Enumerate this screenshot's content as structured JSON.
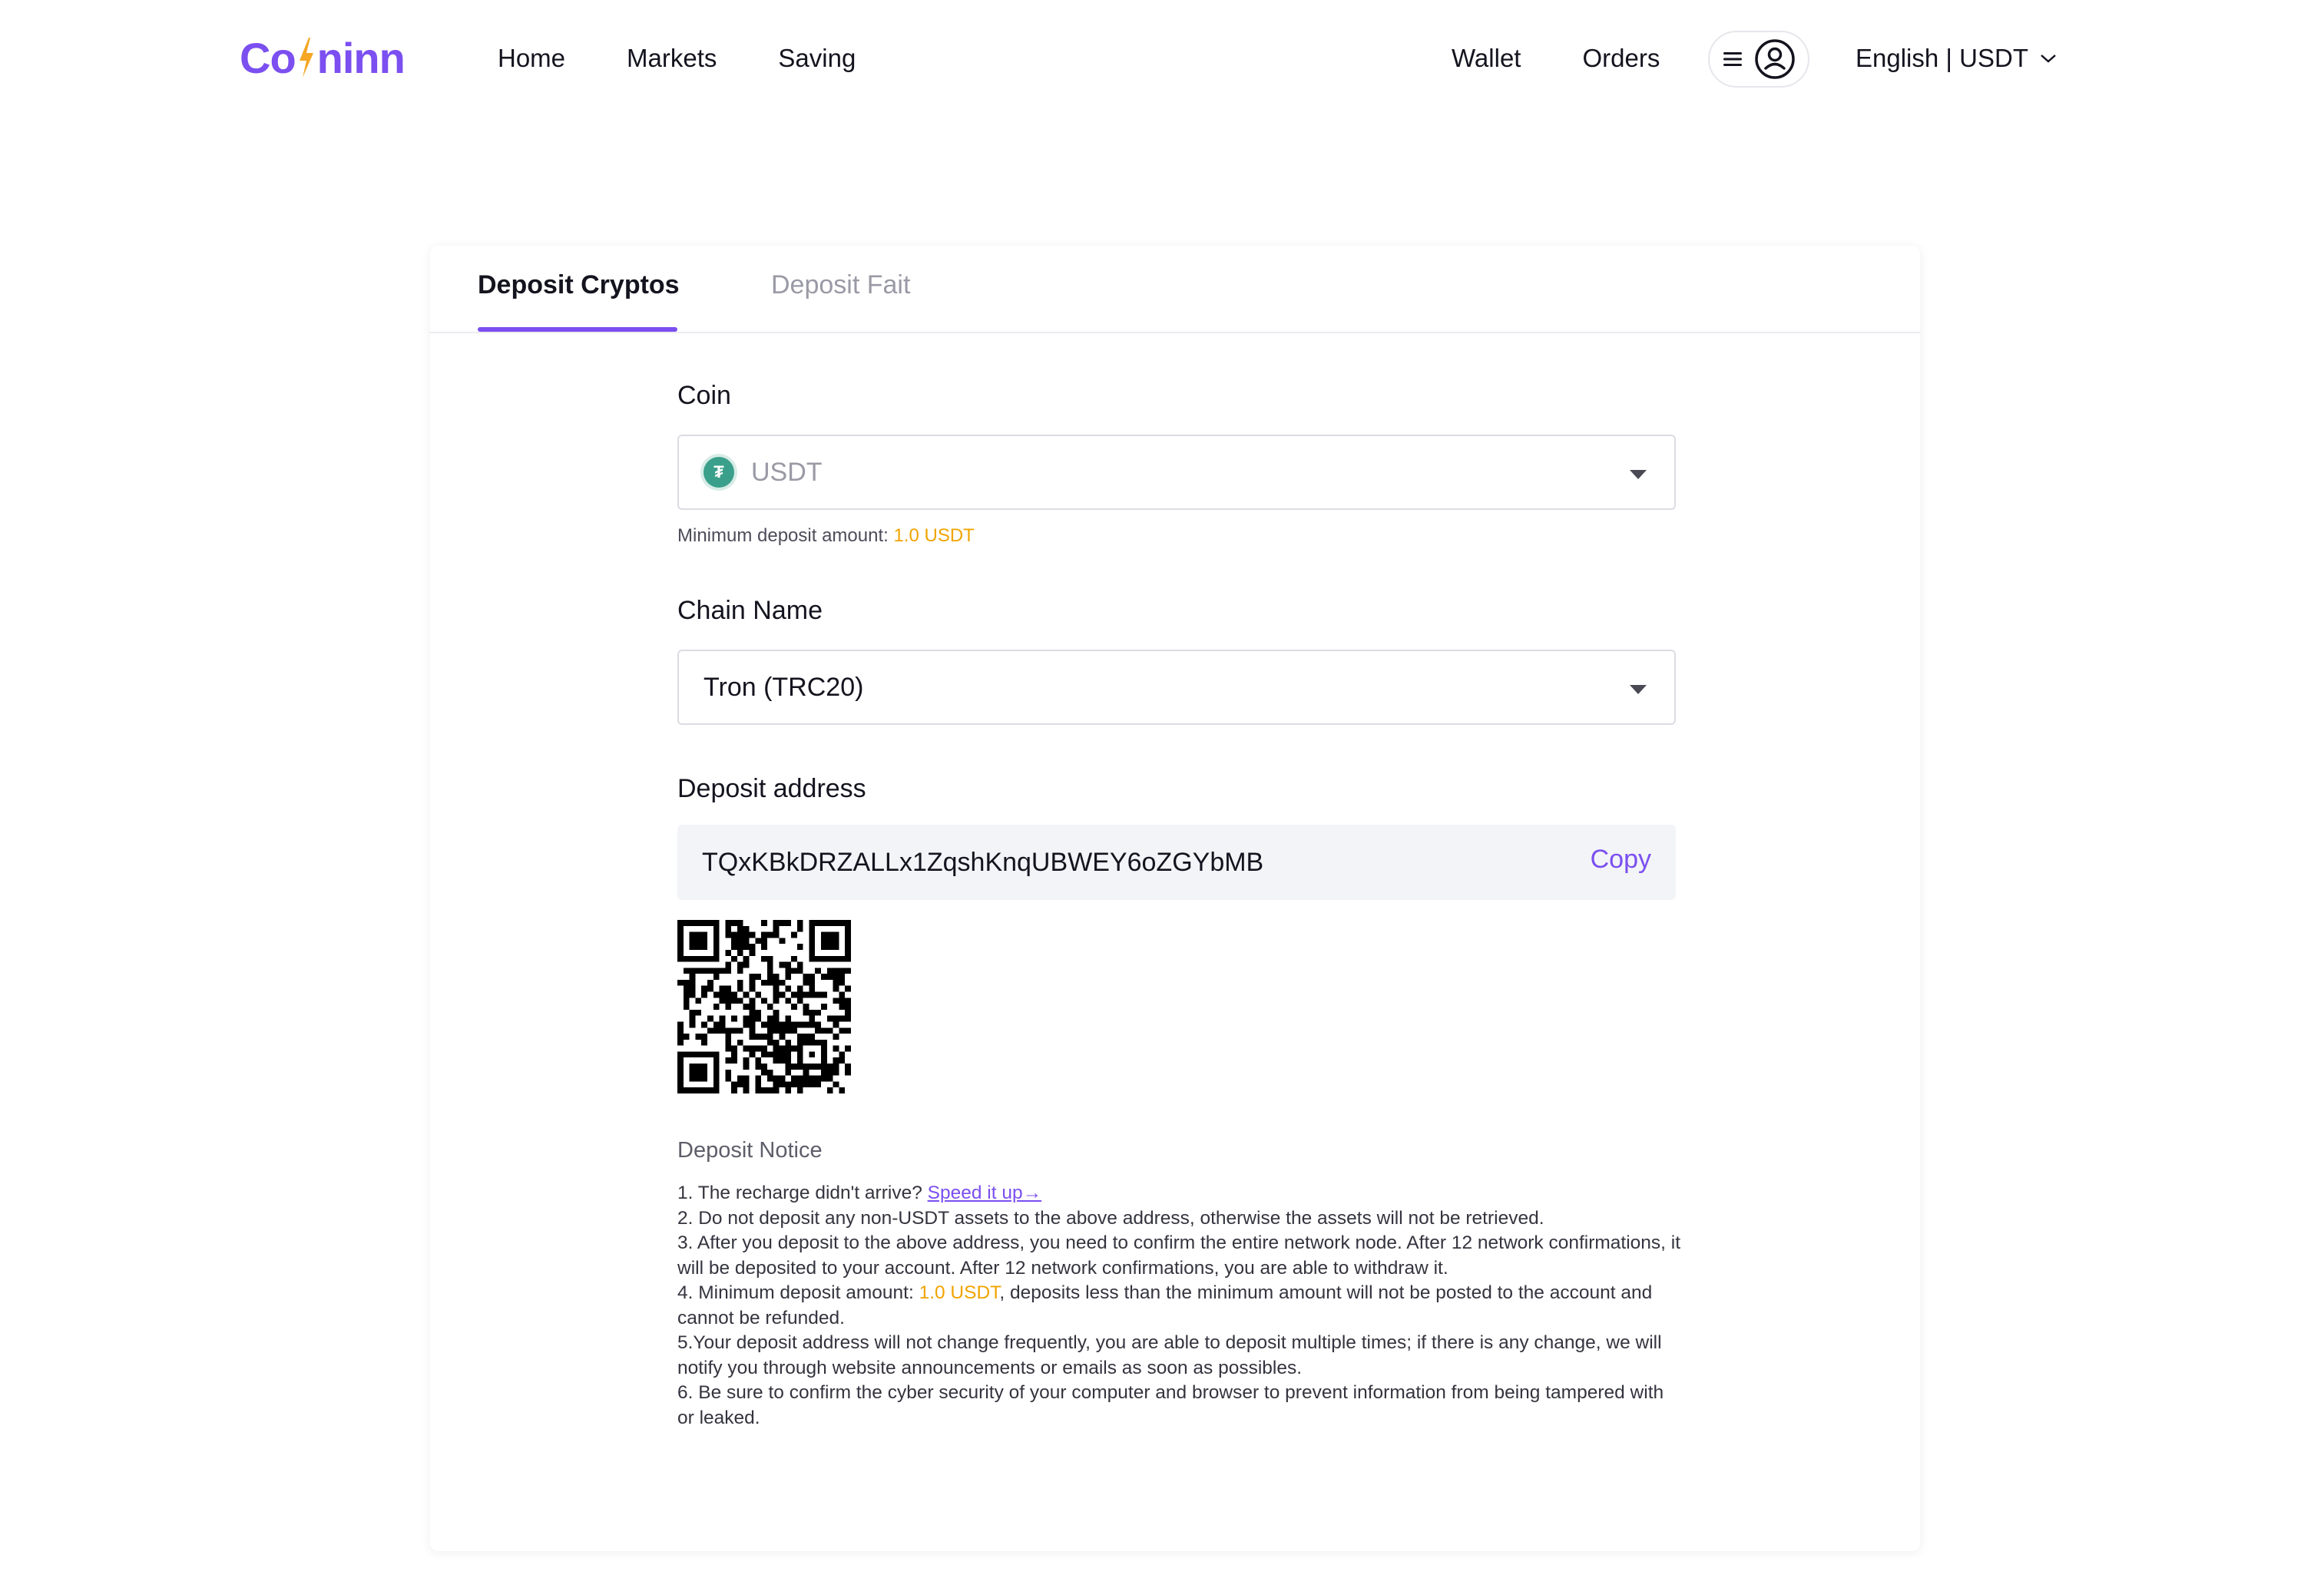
{
  "brand": {
    "logo_text_left": "Co",
    "logo_text_right": "ninn",
    "accent": "#7b4ff0"
  },
  "nav": {
    "left": [
      "Home",
      "Markets",
      "Saving"
    ],
    "right": [
      "Wallet",
      "Orders"
    ],
    "menu_icon": "hamburger-icon",
    "user_icon": "user-icon",
    "language_label": "English | USDT",
    "language_icon": "chevron-down-icon"
  },
  "tabs": {
    "active": "Deposit Cryptos",
    "inactive": "Deposit Fait"
  },
  "coin": {
    "label": "Coin",
    "value": "USDT",
    "icon": "tether-icon",
    "min_prefix": "Minimum deposit amount: ",
    "min_amount": "1.0 USDT"
  },
  "chain": {
    "label": "Chain Name",
    "value": "Tron (TRC20)"
  },
  "address": {
    "label": "Deposit address",
    "value": "TQxKBkDRZALLx1ZqshKnqUBWEY6oZGYbMB",
    "copy_label": "Copy"
  },
  "notice": {
    "title": "Deposit Notice",
    "n1_text": "1. The recharge didn't arrive? ",
    "n1_link": "Speed it up→",
    "n2": "2. Do not deposit any non-USDT assets to the above address, otherwise the assets will not be retrieved.",
    "n3": "3. After you deposit to the above address, you need to confirm the entire network node. After 12 network confirmations, it will be deposited to your account. After 12 network confirmations, you are able to withdraw it.",
    "n4_prefix": "4. Minimum deposit amount: ",
    "n4_amount": "1.0 USDT",
    "n4_suffix": ", deposits less than the minimum amount will not be posted to the account and cannot be refunded.",
    "n5": "5.Your deposit address will not change frequently, you are able to deposit multiple times; if there is any change, we will notify you through website announcements or emails as soon as possibles.",
    "n6": "6. Be sure to confirm the cyber security of your computer and browser to prevent information from being tampered with or leaked."
  }
}
